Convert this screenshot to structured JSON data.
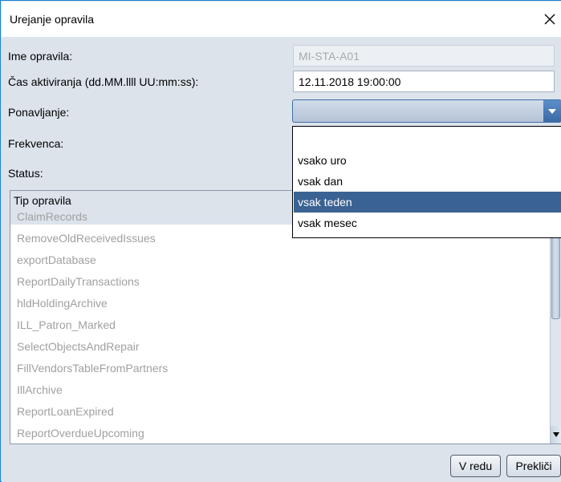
{
  "window": {
    "title": "Urejanje opravila"
  },
  "form": {
    "name_label": "Ime opravila:",
    "name_value": "MI-STA-A01",
    "activation_label": "Čas aktiviranja (dd.MM.llll UU:mm:ss):",
    "activation_value": "12.11.2018 19:00:00",
    "repeat_label": "Ponavljanje:",
    "repeat_value": "",
    "frequency_label": "Frekvenca:",
    "status_label": "Status:"
  },
  "repeat_dropdown": {
    "options": [
      "",
      "vsako uro",
      "vsak dan",
      "vsak teden",
      "vsak mesec"
    ],
    "selected_index": 3
  },
  "task_list": {
    "header": "Tip opravila",
    "items": [
      "ClaimRecords",
      "RemoveOldReceivedIssues",
      "exportDatabase",
      "ReportDailyTransactions",
      "hldHoldingArchive",
      "ILL_Patron_Marked",
      "SelectObjectsAndRepair",
      "FillVendorsTableFromPartners",
      "IllArchive",
      "ReportLoanExpired",
      "ReportOverdueUpcoming"
    ]
  },
  "buttons": {
    "ok_label": "V redu",
    "cancel_label": "Prekliči"
  },
  "colors": {
    "accent": "#3a6393",
    "window_border": "#1883d7",
    "panel_bg": "#dce3eb"
  }
}
